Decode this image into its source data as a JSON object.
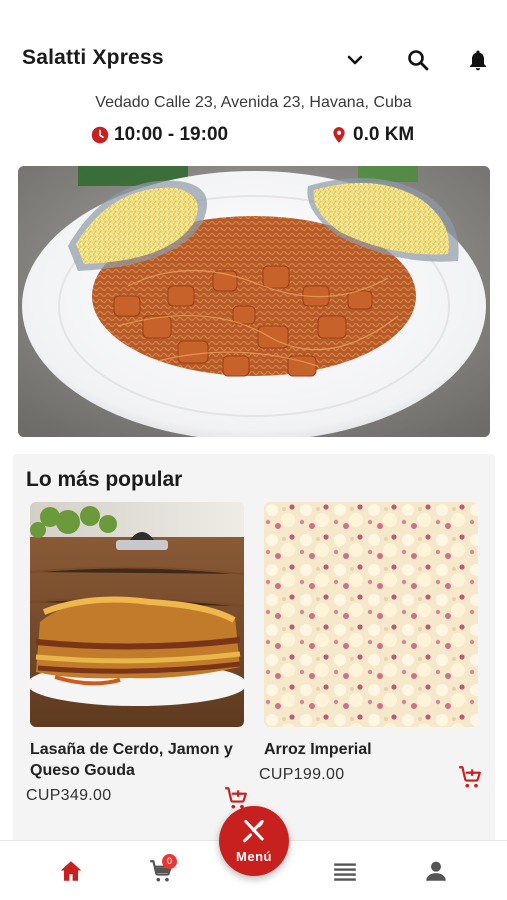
{
  "header": {
    "store_name": "Salatti Xpress",
    "icons": [
      "chevron-down-icon",
      "search-icon",
      "bell-icon"
    ]
  },
  "store_info": {
    "address": "Vedado Calle 23, Avenida 23, Havana, Cuba",
    "hours": "10:00 - 19:00",
    "distance": "0.0 KM",
    "accent_color": "#c81f1f"
  },
  "hero": {
    "image": "spaghetti-with-chicken-and-grated-cheese"
  },
  "popular": {
    "title": "Lo más popular",
    "items": [
      {
        "name": "Lasaña de Cerdo, Jamon y Queso Gouda",
        "price": "CUP349.00",
        "image": "lasagna"
      },
      {
        "name": "Arroz Imperial",
        "price": "CUP199.00",
        "image": "arroz-imperial"
      }
    ]
  },
  "bottom_nav": {
    "cart_count": "0",
    "menu_label": "Menú",
    "items": [
      "home-icon",
      "cart-icon",
      "menu-fab",
      "list-icon",
      "profile-icon"
    ]
  }
}
